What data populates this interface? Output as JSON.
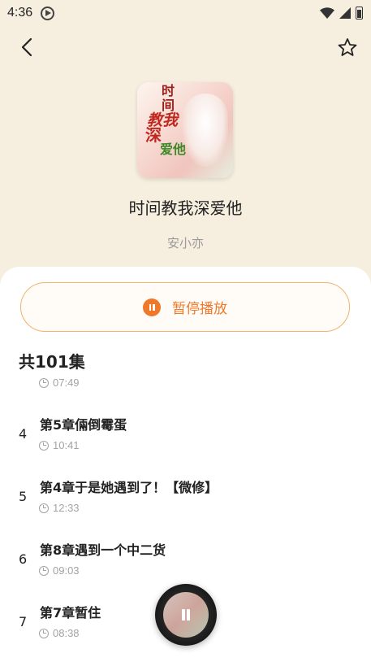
{
  "status_bar": {
    "time": "4:36"
  },
  "book": {
    "title": "时间教我深爱他",
    "author": "安小亦",
    "cover_text": [
      "时",
      "间",
      "教我",
      "深",
      "爱他"
    ]
  },
  "play_control": {
    "label": "暂停播放"
  },
  "episodes": {
    "count_label": "共101集",
    "items": [
      {
        "num": "",
        "title": "",
        "duration": "07:49"
      },
      {
        "num": "4",
        "title": "第5章倆倒霉蛋",
        "duration": "10:41"
      },
      {
        "num": "5",
        "title": "第4章于是她遇到了！【微修】",
        "duration": "12:33"
      },
      {
        "num": "6",
        "title": "第8章遇到一个中二货",
        "duration": "09:03"
      },
      {
        "num": "7",
        "title": "第7章暂住",
        "duration": "08:38"
      }
    ]
  },
  "colors": {
    "background": "#f6efdf",
    "accent": "#f0782a",
    "accent_border": "#f2b36f",
    "muted_text": "#a3a3a3"
  },
  "icons": {
    "back": "chevron-left-icon",
    "favorite": "star-outline-icon",
    "pause": "pause-icon",
    "clock": "clock-icon"
  }
}
